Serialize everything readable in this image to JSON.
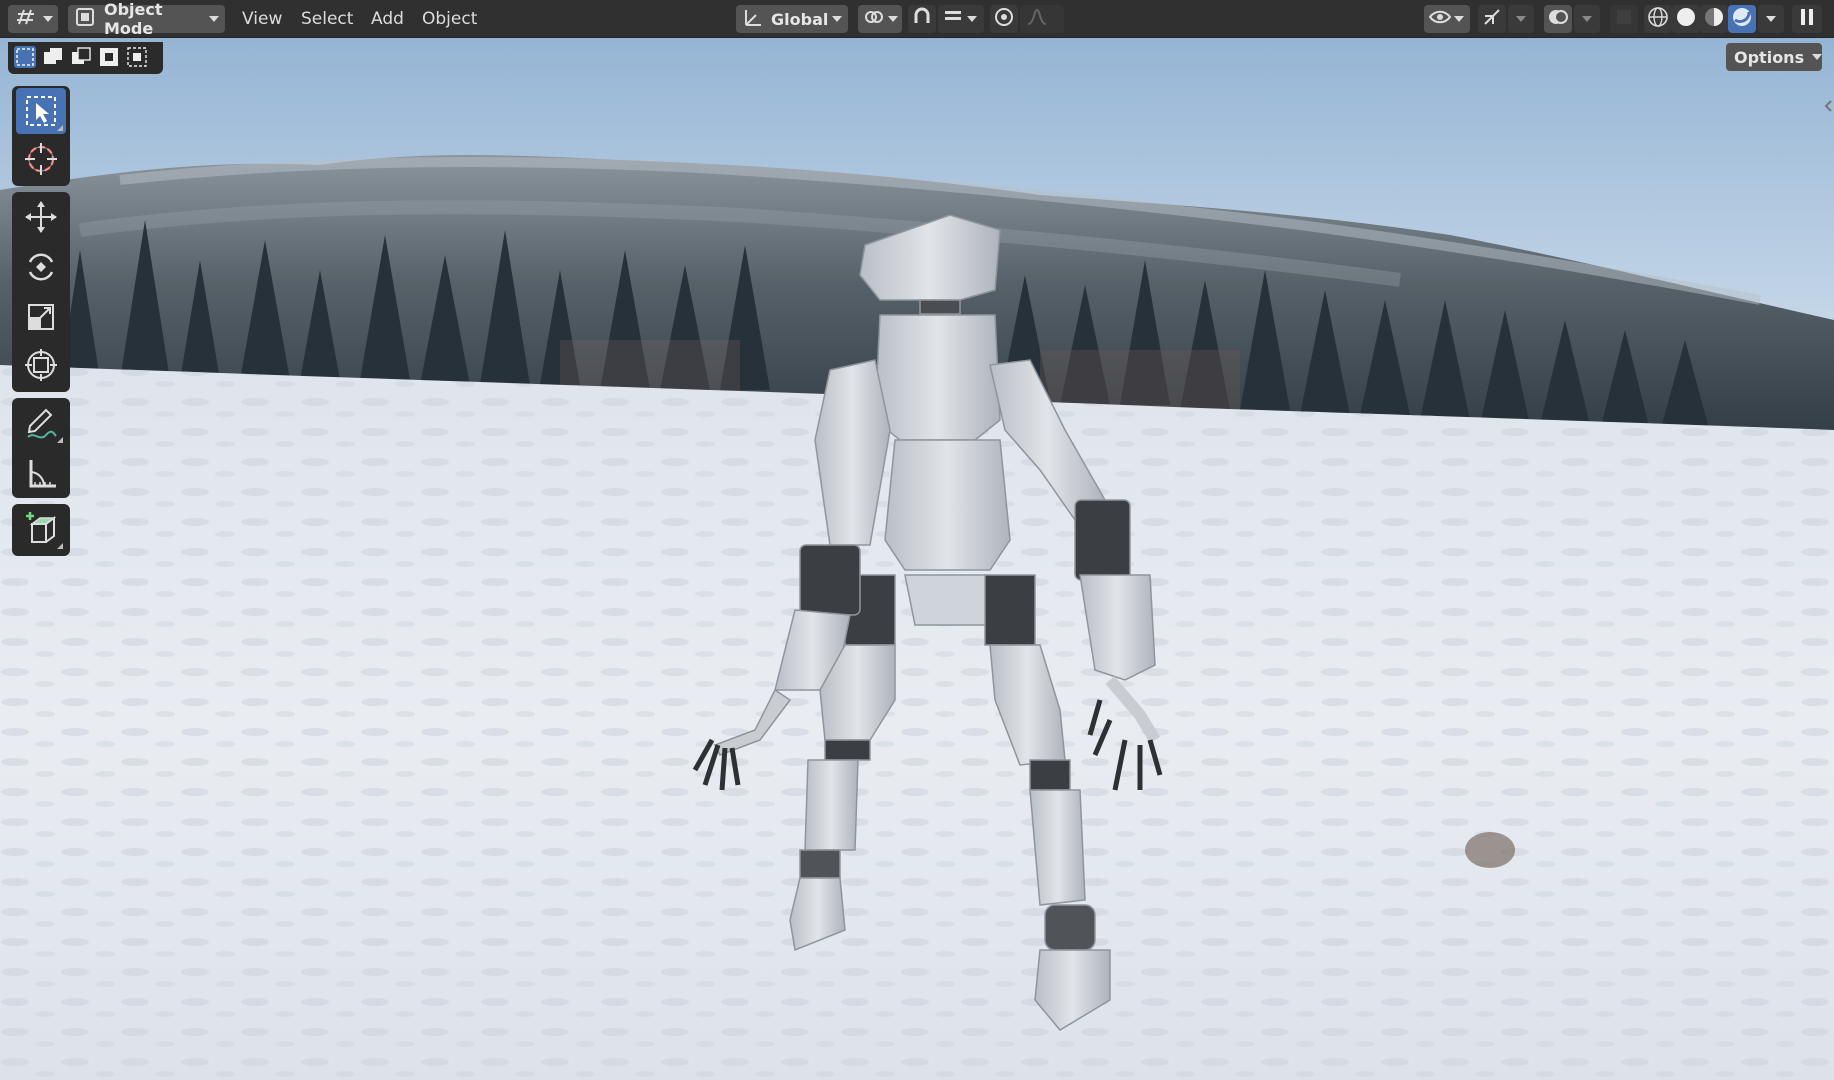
{
  "header": {
    "editor_type_icon": "3d-viewport-icon",
    "mode_label": "Object Mode",
    "menus": [
      "View",
      "Select",
      "Add",
      "Object"
    ],
    "orientation_label": "Global",
    "pivot_icon": "pivot-point-icon",
    "snap_icon": "snap-magnet-icon",
    "proportional_icon": "proportional-edit-icon",
    "visibility_icon": "eye-icon",
    "gizmo_icon": "gizmo-icon",
    "overlay_icon": "overlays-icon",
    "xray_icon": "xray-icon",
    "shading_modes": [
      "wireframe",
      "solid",
      "material-preview",
      "rendered"
    ],
    "active_shading": "rendered",
    "pause_icon": "pause-icon"
  },
  "selection_modes": [
    "select-new",
    "select-extend",
    "select-subtract",
    "select-invert",
    "select-intersect"
  ],
  "options_label": "Options",
  "toolbar": {
    "tools": [
      {
        "name": "select-box",
        "active": true
      },
      {
        "name": "cursor",
        "active": false
      },
      {
        "name": "move",
        "active": false
      },
      {
        "name": "rotate",
        "active": false
      },
      {
        "name": "scale",
        "active": false
      },
      {
        "name": "transform",
        "active": false
      },
      {
        "name": "annotate",
        "active": false
      },
      {
        "name": "measure",
        "active": false
      },
      {
        "name": "add-cube",
        "active": false
      }
    ]
  },
  "scene": {
    "description_colors": {
      "sky_top": "#9fb8d4",
      "sky_bottom": "#c9d9e8",
      "snow": "#e4e8ee",
      "forest": "#3f4a52",
      "robot": "#cfd3d8",
      "robot_dark": "#3b3e42"
    }
  },
  "colors": {
    "header_bg": "#303030",
    "button_bg": "#545454",
    "accent_blue": "#4772b3",
    "panel_bg": "#2a2a2a"
  }
}
